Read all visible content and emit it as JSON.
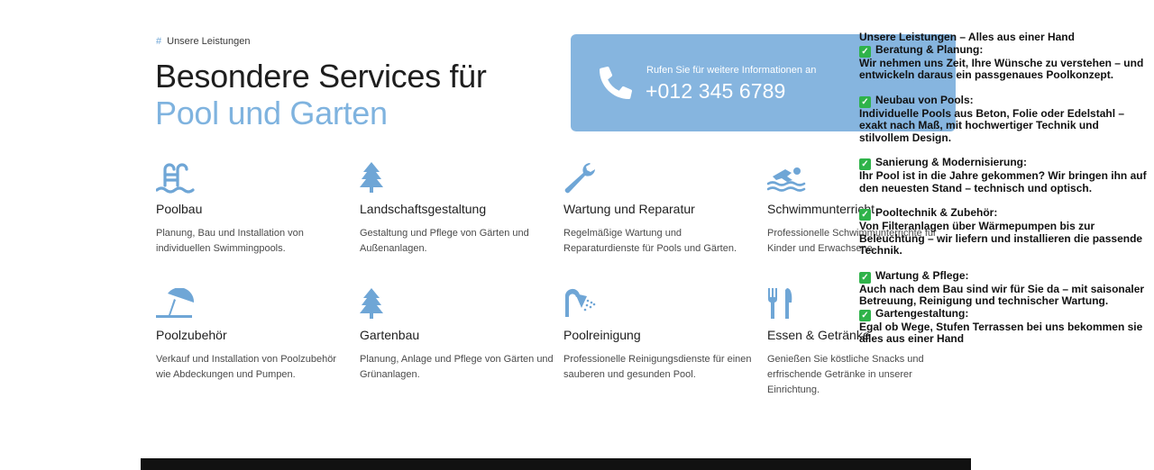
{
  "header": {
    "eyebrow_marker": "#",
    "eyebrow": "Unsere Leistungen",
    "title_line1": "Besondere Services für",
    "title_line2": "Pool und Garten"
  },
  "cta": {
    "label": "Rufen Sie für weitere Informationen an",
    "phone": "+012 345 6789",
    "icon": "phone-icon"
  },
  "services": [
    {
      "icon": "pool-ladder-icon",
      "name": "Poolbau",
      "desc": "Planung, Bau und Installation von individuellen Swimmingpools."
    },
    {
      "icon": "tree-icon",
      "name": "Landschaftsgestaltung",
      "desc": "Gestaltung und Pflege von Gärten und Außenanlagen."
    },
    {
      "icon": "wrench-icon",
      "name": "Wartung und Reparatur",
      "desc": "Regelmäßige Wartung und Reparaturdienste für Pools und Gärten."
    },
    {
      "icon": "swimmer-icon",
      "name": "Schwimmunterricht",
      "desc": "Professionelle Schwimmunterrichte für Kinder und Erwachsene."
    },
    {
      "icon": "umbrella-beach-icon",
      "name": "Poolzubehör",
      "desc": "Verkauf und Installation von Poolzubehör wie Abdeckungen und Pumpen."
    },
    {
      "icon": "tree-icon",
      "name": "Gartenbau",
      "desc": "Planung, Anlage und Pflege von Gärten und Grünanlagen."
    },
    {
      "icon": "shower-icon",
      "name": "Poolreinigung",
      "desc": "Professionelle Reinigungsdienste für einen sauberen und gesunden Pool."
    },
    {
      "icon": "utensils-icon",
      "name": "Essen & Getränke",
      "desc": "Genießen Sie köstliche Snacks und erfrischende Getränke in unserer Einrichtung."
    }
  ],
  "overlay": {
    "heading": "Unsere Leistungen – Alles aus einer Hand",
    "items": [
      {
        "title": "Beratung & Planung:",
        "body": "Wir nehmen uns Zeit, Ihre Wünsche zu verstehen – und entwickeln daraus ein passgenaues Poolkonzept."
      },
      {
        "title": "Neubau von Pools:",
        "body": "Individuelle Pools aus Beton, Folie oder Edelstahl – exakt nach Maß, mit hochwertiger Technik und stilvollem Design."
      },
      {
        "title": "Sanierung & Modernisierung:",
        "body": "Ihr Pool ist in die Jahre gekommen? Wir bringen ihn auf den neuesten Stand – technisch und optisch."
      },
      {
        "title": "Pooltechnik & Zubehör:",
        "body": "Von Filteranlagen über Wärmepumpen bis zur Beleuchtung – wir liefern und installieren die passende Technik."
      },
      {
        "title": "Wartung & Pflege:",
        "body": "Auch nach dem Bau sind wir für Sie da – mit saisonaler Betreuung, Reinigung und technischer Wartung."
      },
      {
        "title": "Gartengestaltung:",
        "body": "Egal ob Wege, Stufen Terrassen bei uns bekommen sie alles aus einer Hand"
      }
    ]
  },
  "colors": {
    "accent": "#86b5df",
    "title_accent": "#7fb3df",
    "icon": "#6fa6d6"
  }
}
